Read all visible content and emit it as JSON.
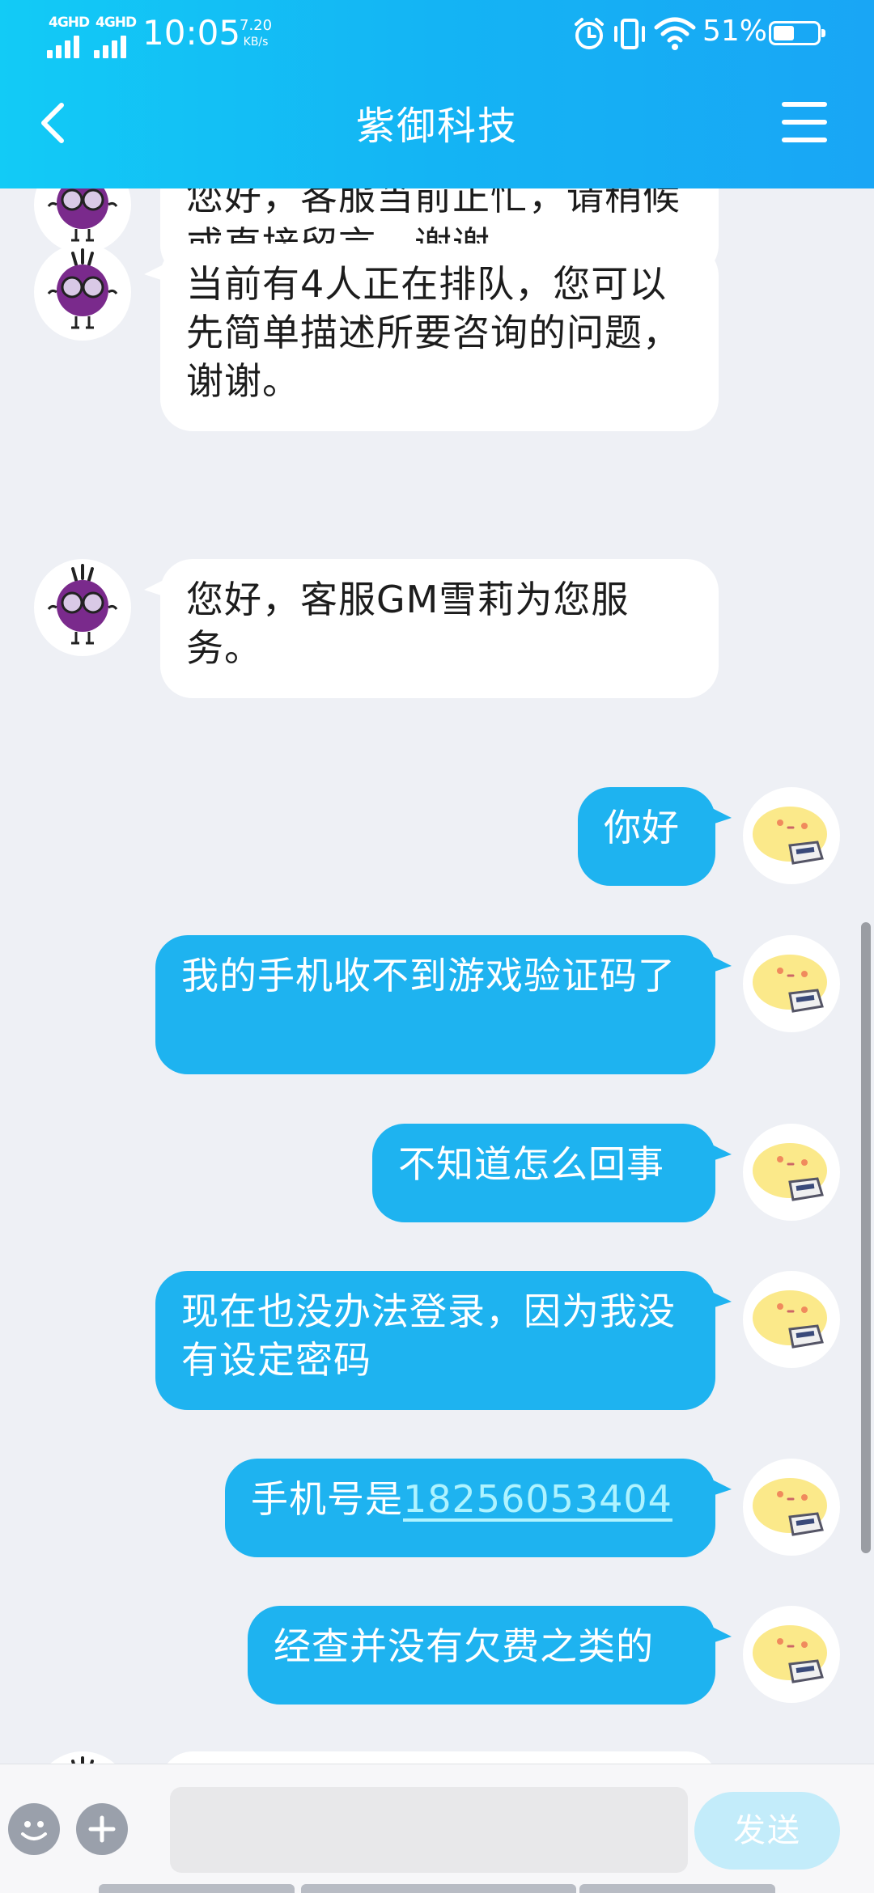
{
  "status_bar": {
    "network_1": "4GHD",
    "network_2": "4GHD",
    "time": "10:05",
    "speed_value": "7.20",
    "speed_unit": "KB/s",
    "icons": [
      "alarm-icon",
      "vibrate-icon",
      "wifi-icon"
    ],
    "battery_percent": "51%"
  },
  "header": {
    "title": "紫御科技",
    "back_icon": "chevron-left-icon",
    "menu_icon": "hamburger-menu-icon"
  },
  "messages": [
    {
      "side": "left",
      "sender": "agent",
      "text": "您好，客服当前正忙，请稍候或直接留言，谢谢。"
    },
    {
      "side": "left",
      "sender": "agent",
      "text": "当前有4人正在排队，您可以先简单描述所要咨询的问题，谢谢。"
    },
    {
      "side": "left",
      "sender": "agent",
      "text": "您好，客服GM雪莉为您服务。"
    },
    {
      "side": "right",
      "sender": "user",
      "text": "你好"
    },
    {
      "side": "right",
      "sender": "user",
      "text": "我的手机收不到游戏验证码了"
    },
    {
      "side": "right",
      "sender": "user",
      "text": "不知道怎么回事"
    },
    {
      "side": "right",
      "sender": "user",
      "text": "现在也没办法登录，因为我没有设定密码"
    },
    {
      "side": "right",
      "sender": "user",
      "text": "手机号是",
      "link": "18256053404"
    },
    {
      "side": "right",
      "sender": "user",
      "text": "经查并没有欠费之类的"
    }
  ],
  "input_bar": {
    "emoji_icon": "emoji-icon",
    "add_icon": "plus-icon",
    "text_value": "",
    "send_label": "发送"
  },
  "colors": {
    "header_start": "#12cbf6",
    "header_end": "#19a6f5",
    "user_bubble": "#1eb3f0",
    "agent_bubble": "#ffffff",
    "chat_bg": "#eef0f5",
    "send_button": "#c3ecfa"
  }
}
